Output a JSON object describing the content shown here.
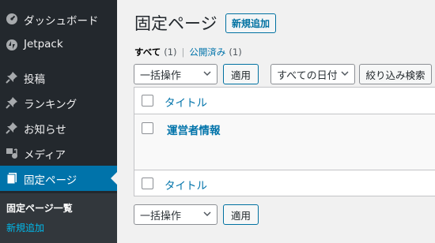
{
  "sidebar": {
    "items": [
      {
        "label": "ダッシュボード",
        "icon": "dashboard-icon"
      },
      {
        "label": "Jetpack",
        "icon": "jetpack-icon"
      },
      {
        "label": "投稿",
        "icon": "pin-icon"
      },
      {
        "label": "ランキング",
        "icon": "pin-icon"
      },
      {
        "label": "お知らせ",
        "icon": "pin-icon"
      },
      {
        "label": "メディア",
        "icon": "media-icon"
      },
      {
        "label": "固定ページ",
        "icon": "page-icon",
        "active": true
      }
    ],
    "submenu": {
      "current": "固定ページ一覧",
      "add_new": "新規追加"
    }
  },
  "header": {
    "title": "固定ページ",
    "add_new": "新規追加"
  },
  "filters": {
    "all_label": "すべて",
    "all_count": "(1)",
    "separator": "|",
    "published_label": "公開済み",
    "published_count": "(1)"
  },
  "tablenav_top": {
    "bulk_action": "一括操作",
    "apply": "適用",
    "date_filter": "すべての日付",
    "filter_button": "絞り込み検索"
  },
  "table": {
    "header_title": "タイトル",
    "rows": [
      {
        "title": "運営者情報"
      }
    ],
    "footer_title": "タイトル"
  },
  "tablenav_bottom": {
    "bulk_action": "一括操作",
    "apply": "適用"
  },
  "colors": {
    "sidebar_bg": "#23282d",
    "active_bg": "#0073aa",
    "link": "#0073aa"
  }
}
